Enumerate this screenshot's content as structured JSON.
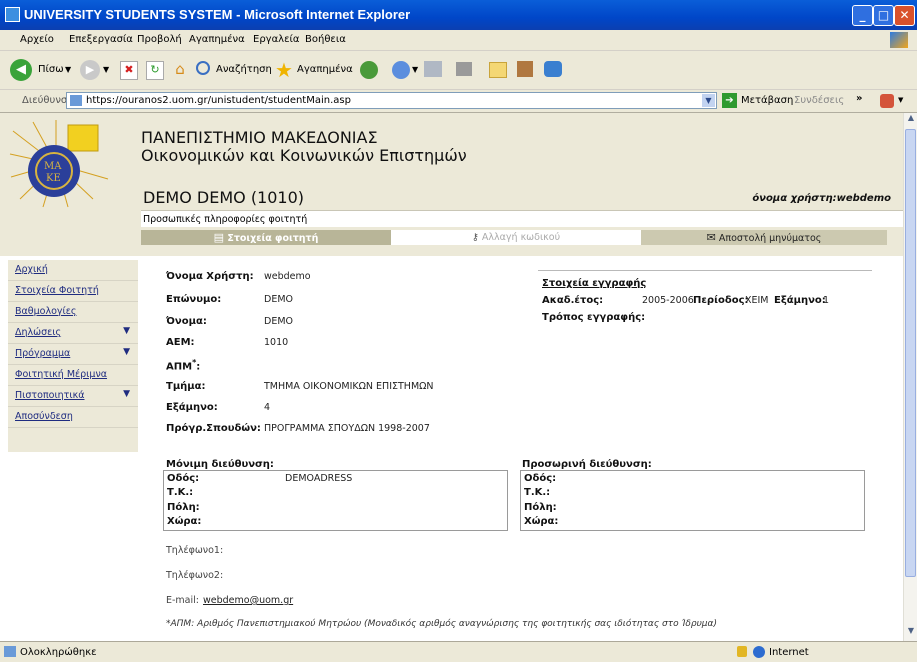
{
  "window": {
    "title": "UNIVERSITY STUDENTS SYSTEM - Microsoft Internet Explorer",
    "min": "_",
    "max": "□",
    "close": "✕"
  },
  "menu": [
    "Αρχείο",
    "Επεξεργασία",
    "Προβολή",
    "Αγαπημένα",
    "Εργαλεία",
    "Βοήθεια"
  ],
  "toolbar": {
    "back_label": "Πίσω",
    "search_label": "Αναζήτηση",
    "favorites_label": "Αγαπημένα"
  },
  "address": {
    "label": "Διεύθυνση",
    "url": "https://ouranos2.uom.gr/unistudent/studentMain.asp",
    "go_label": "Μετάβαση",
    "links_label": "Συνδέσεις",
    "chevron": "»"
  },
  "header": {
    "uni_name": "ΠΑΝΕΠΙΣΤΗΜΙΟ ΜΑΚΕΔΟΝΙΑΣ",
    "faculty": "Οικονομικών και Κοινωνικών Επιστημών",
    "student_name": "DEMO DEMO (1010)",
    "username_line": "όνομα χρήστη:webdemo",
    "subtitle": "Προσωπικές πληροφορίες φοιτητή"
  },
  "tabs": [
    {
      "label": "Στοιχεία φοιτητή"
    },
    {
      "label": "Αλλαγή κωδικού"
    },
    {
      "label": "Αποστολή μηνύματος"
    }
  ],
  "nav": [
    {
      "label": "Αρχική",
      "arrow": ""
    },
    {
      "label": "Στοιχεία Φοιτητή",
      "arrow": ""
    },
    {
      "label": "Βαθμολογίες",
      "arrow": ""
    },
    {
      "label": "Δηλώσεις",
      "arrow": "▼"
    },
    {
      "label": "Πρόγραμμα",
      "arrow": "▼"
    },
    {
      "label": "Φοιτητική Μέριμνα",
      "arrow": ""
    },
    {
      "label": "Πιστοποιητικά",
      "arrow": "▼"
    },
    {
      "label": "Αποσύνδεση",
      "arrow": ""
    }
  ],
  "student": {
    "rows": [
      {
        "label": "Όνομα Χρήστη:",
        "value": "webdemo"
      },
      {
        "label": "Επώνυμο:",
        "value": "DEMO"
      },
      {
        "label": "Όνομα:",
        "value": "DEMO"
      },
      {
        "label": "ΑΕΜ:",
        "value": "1010"
      },
      {
        "label": "ΑΠΜ",
        "value": ""
      },
      {
        "label": "Τμήμα:",
        "value": "ΤΜΗΜΑ ΟΙΚΟΝΟΜΙΚΩΝ ΕΠΙΣΤΗΜΩΝ"
      },
      {
        "label": "Εξάμηνο:",
        "value": "4"
      },
      {
        "label": "Πρόγρ.Σπουδών:",
        "value": "ΠΡΟΓΡΑΜΜΑ ΣΠΟΥΔΩΝ 1998-2007"
      }
    ],
    "apm_star": "*",
    "apm_colon": ":"
  },
  "registration": {
    "title": "Στοιχεία εγγραφής",
    "acad_label": "Ακαδ.έτος:",
    "acad_value": "2005-2006",
    "period_label": "Περίοδος:",
    "period_value": "ΧΕΙΜ",
    "semester_label": "Εξάμηνο:",
    "semester_value": "1",
    "mode_label": "Τρόπος εγγραφής:"
  },
  "permanent_address": {
    "title": "Μόνιμη διεύθυνση:",
    "street_label": "Οδός:",
    "street_value": "DEMOADRESS",
    "zip_label": "Τ.Κ.:",
    "city_label": "Πόλη:",
    "country_label": "Χώρα:"
  },
  "temp_address": {
    "title": "Προσωρινή διεύθυνση:",
    "street_label": "Οδός:",
    "zip_label": "Τ.Κ.:",
    "city_label": "Πόλη:",
    "country_label": "Χώρα:"
  },
  "contact": {
    "phone1": "Τηλέφωνο1:",
    "phone2": "Τηλέφωνο2:",
    "email_label": "E-mail:",
    "email": "webdemo@uom.gr"
  },
  "footnote": "*ΑΠΜ: Αριθμός Πανεπιστημιακού Μητρώου (Μοναδικός αριθμός αναγνώρισης της φοιτητικής σας ιδιότητας στο Ίδρυμα)",
  "status": {
    "left": "Ολοκληρώθηκε",
    "zone": "Internet"
  }
}
